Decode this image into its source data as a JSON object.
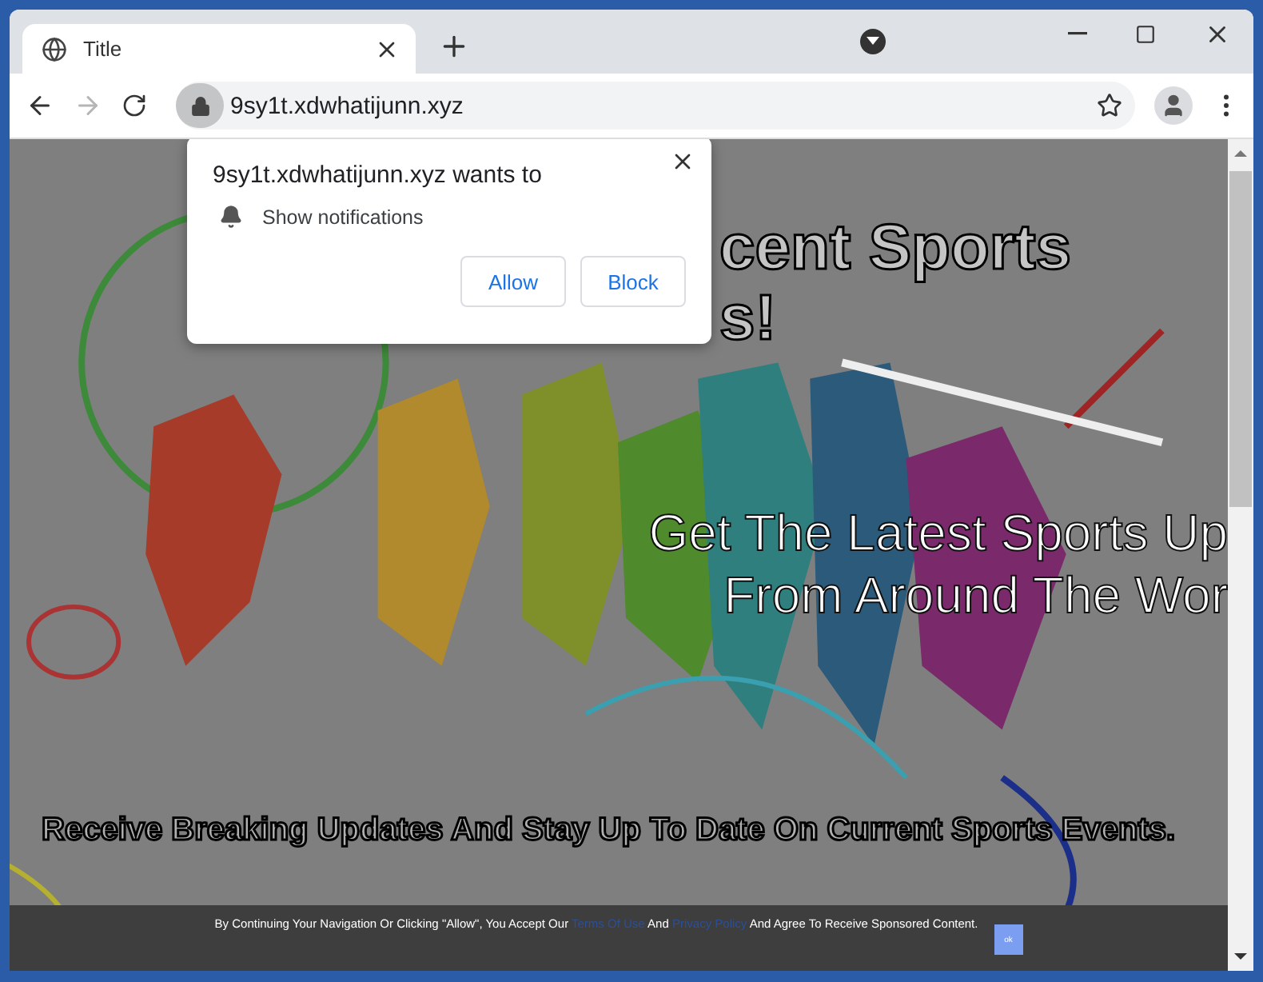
{
  "browser": {
    "tab": {
      "title": "Title"
    },
    "address": "9sy1t.xdwhatijunn.xyz",
    "forward_disabled": true
  },
  "permission_popup": {
    "title": "9sy1t.xdwhatijunn.xyz wants to",
    "permission": "Show notifications",
    "buttons": [
      "Allow",
      "Block"
    ]
  },
  "page": {
    "heading_fragments": [
      "cent Sports",
      "s!"
    ],
    "subheading": [
      "Get The Latest Sports Up",
      "From Around The Wor"
    ],
    "tagline": "Receive Breaking Updates And Stay Up To Date On Current Sports Events.",
    "consent": {
      "text_before": "By Continuing Your Navigation Or Clicking \"Allow\", You Accept Our",
      "terms_link": "Terms Of Use",
      "middle": "And",
      "privacy_link": "Privacy Policy",
      "text_after": "And Agree To Receive Sponsored Content.",
      "ok_button": "ok"
    }
  }
}
